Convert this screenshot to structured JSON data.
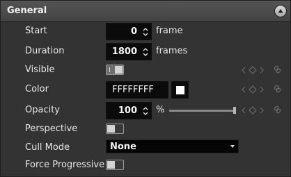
{
  "section": {
    "title": "General",
    "collapse_icon": "chevron-up-icon"
  },
  "rows": {
    "start": {
      "label": "Start",
      "value": "0",
      "unit": "frame"
    },
    "duration": {
      "label": "Duration",
      "value": "1800",
      "unit": "frames"
    },
    "visible": {
      "label": "Visible",
      "state": "on"
    },
    "color": {
      "label": "Color",
      "value": "FFFFFFFF",
      "swatch": "#ffffff"
    },
    "opacity": {
      "label": "Opacity",
      "value": "100",
      "unit": "%",
      "slider_level": 1.0
    },
    "perspective": {
      "label": "Perspective",
      "state": "off"
    },
    "cull_mode": {
      "label": "Cull Mode",
      "value": "None"
    },
    "force_progressive": {
      "label": "Force Progressive",
      "state": "off"
    }
  },
  "keyframe_icons": [
    "prev-key-icon",
    "add-key-icon",
    "next-key-icon",
    "link-icon"
  ]
}
